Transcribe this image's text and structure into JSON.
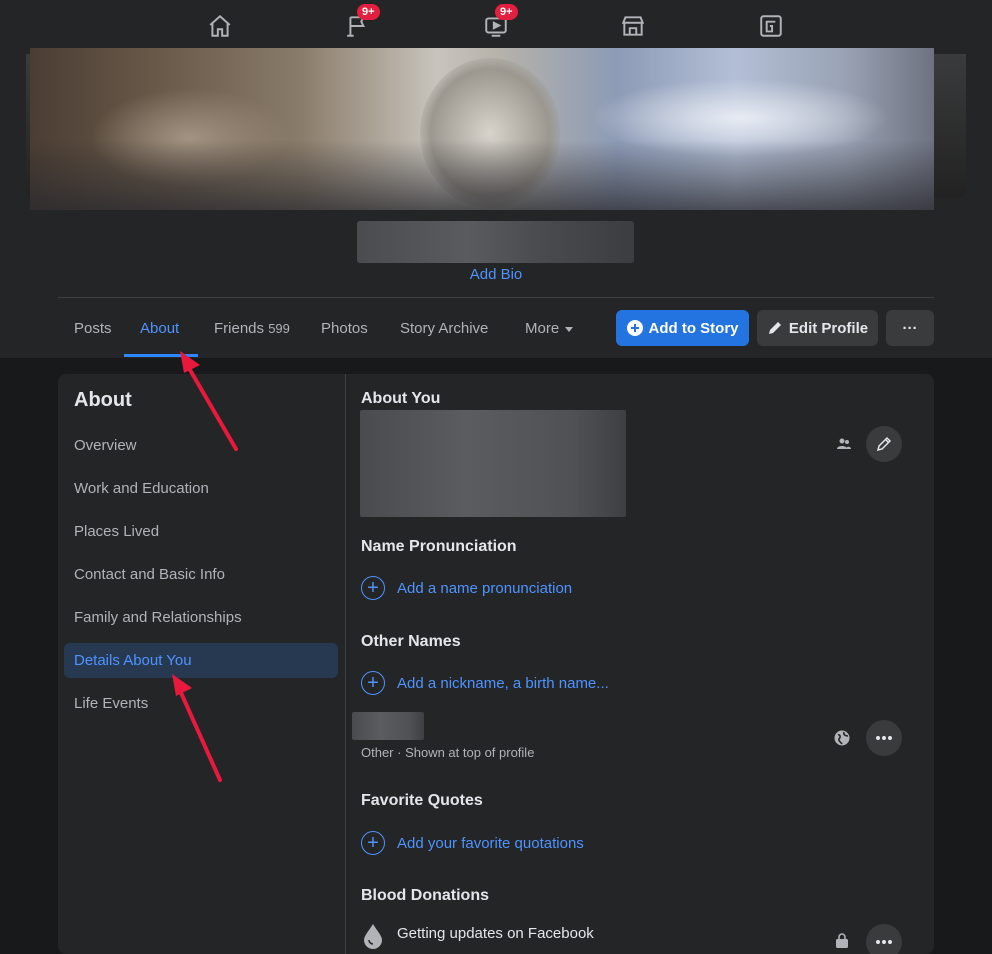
{
  "topnav": {
    "items": [
      {
        "name": "home",
        "badge": ""
      },
      {
        "name": "pages",
        "badge": "9+"
      },
      {
        "name": "watch",
        "badge": "9+"
      },
      {
        "name": "marketplace",
        "badge": ""
      },
      {
        "name": "gaming",
        "badge": ""
      }
    ]
  },
  "profile": {
    "add_bio": "Add Bio"
  },
  "tabs": [
    {
      "label": "Posts"
    },
    {
      "label": "About"
    },
    {
      "label": "Friends",
      "count": "599"
    },
    {
      "label": "Photos"
    },
    {
      "label": "Story Archive"
    },
    {
      "label": "More"
    }
  ],
  "actions": {
    "add_to_story": "Add to Story",
    "edit_profile": "Edit Profile",
    "more": "···"
  },
  "about": {
    "title": "About",
    "menu": [
      "Overview",
      "Work and Education",
      "Places Lived",
      "Contact and Basic Info",
      "Family and Relationships",
      "Details About You",
      "Life Events"
    ]
  },
  "details": {
    "about_you_title": "About You",
    "name_pronunciation_title": "Name Pronunciation",
    "add_name_pronunciation": "Add a name pronunciation",
    "other_names_title": "Other Names",
    "add_nickname": "Add a nickname, a birth name...",
    "other_name_meta": "Other · Shown at top of profile",
    "favorite_quotes_title": "Favorite Quotes",
    "add_quotes": "Add your favorite quotations",
    "blood_donations_title": "Blood Donations",
    "blood_donations_text": "Getting updates on Facebook"
  },
  "colors": {
    "accent": "#2d88ff",
    "link": "#4e93ff",
    "badge": "#e41e3f",
    "annotation_arrow": "#e8193c"
  }
}
